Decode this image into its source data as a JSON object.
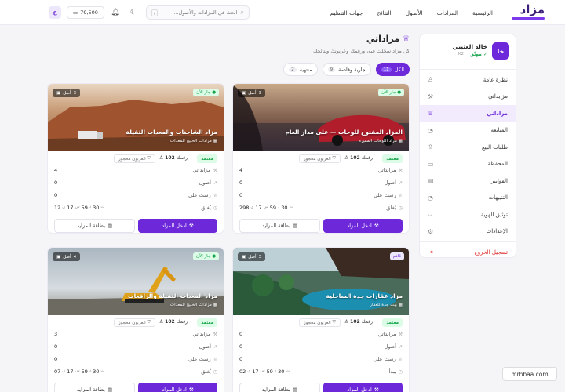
{
  "brand": {
    "logo_text": "مزاد"
  },
  "nav": {
    "items": [
      "الرئيسية",
      "المزادات",
      "الأصول",
      "النتائج",
      "جهات التنظيم"
    ]
  },
  "search": {
    "placeholder": "ابحث في المزادات والأصول...",
    "shortcut": "/"
  },
  "header": {
    "wallet": "79,500",
    "avatar_initials": "ع"
  },
  "user": {
    "initials": "خا",
    "name": "خالد العتيبي",
    "status": "موثّق",
    "code": "K2"
  },
  "sidebar": {
    "items": [
      {
        "label": "نظرة عامة",
        "icon": "user-icon"
      },
      {
        "label": "مزايداتي",
        "icon": "gavel-icon"
      },
      {
        "label": "مزاداتي",
        "icon": "trophy-icon",
        "active": true
      },
      {
        "label": "المتابعة",
        "icon": "bell-icon"
      },
      {
        "label": "طلبات البيع",
        "icon": "upload-icon"
      },
      {
        "label": "المحفظة",
        "icon": "wallet-icon"
      },
      {
        "label": "الفواتير",
        "icon": "file-icon"
      },
      {
        "label": "التنبيهات",
        "icon": "bell-icon"
      },
      {
        "label": "توثيق الهوية",
        "icon": "shield-icon"
      },
      {
        "label": "الإعدادات",
        "icon": "gear-icon"
      }
    ],
    "logout": "تسجيل الخروج"
  },
  "page": {
    "title": "مزاداتي",
    "subtitle": "كل مزاد سجّلت فيه، ورقمك وعربونك ونتائجك",
    "filters": [
      {
        "label": "الكل",
        "count": "11",
        "active": true
      },
      {
        "label": "جارية وقادمة",
        "count": "9"
      },
      {
        "label": "منتهية",
        "count": "2"
      }
    ]
  },
  "labels": {
    "approved": "معتمد",
    "deposit": "العربون محجوز",
    "paddle_prefix": "رقمك",
    "bids_label": "مزايداتي",
    "won_label": "أصول",
    "leading_label": "رست علي",
    "closes_label": "يُغلق",
    "starts_label": "يبدأ",
    "enter_btn": "ادخل المزاد",
    "card_btn": "بطاقة المزايد",
    "lots_suffix": "أصل"
  },
  "cards": [
    {
      "status": "جار الآن",
      "status_type": "live",
      "lots": "3",
      "title": "المزاد المفتوح للوحات — على مدار العام",
      "subtitle": "مزاد اللوحات المميزة",
      "paddle": "102",
      "bids": "4",
      "won": "0",
      "leading": "0",
      "timer_label": "يُغلق",
      "timer": [
        "298",
        "17",
        "59",
        "30"
      ]
    },
    {
      "status": "جار الآن",
      "status_type": "live",
      "lots": "3",
      "title": "مزاد الشاحنات والمعدات الثقيلة",
      "subtitle": "مزادات الخليج للمعدات",
      "paddle": "102",
      "bids": "4",
      "won": "0",
      "leading": "0",
      "timer_label": "يُغلق",
      "timer": [
        "12",
        "17",
        "59",
        "30"
      ]
    },
    {
      "status": "قادم",
      "status_type": "upcoming",
      "lots": "3",
      "title": "مزاد عقارات جدة الساحلية",
      "subtitle": "بيت جدة للعقار",
      "paddle": "102",
      "bids": "0",
      "won": "0",
      "leading": "0",
      "timer_label": "يبدأ",
      "timer": [
        "02",
        "17",
        "59",
        "30"
      ]
    },
    {
      "status": "جار الآن",
      "status_type": "live",
      "lots": "4",
      "title": "مزاد المعدات الثقيلة والرافعات",
      "subtitle": "مزادات الخليج للمعدات",
      "paddle": "102",
      "bids": "3",
      "won": "0",
      "leading": "0",
      "timer_label": "يُغلق",
      "timer": [
        "07",
        "17",
        "59",
        "30"
      ]
    }
  ],
  "watermark": "mrhbaa.com",
  "colors": {
    "accent": "#6d28d9",
    "live": "#16a34a",
    "danger": "#dc2626"
  }
}
